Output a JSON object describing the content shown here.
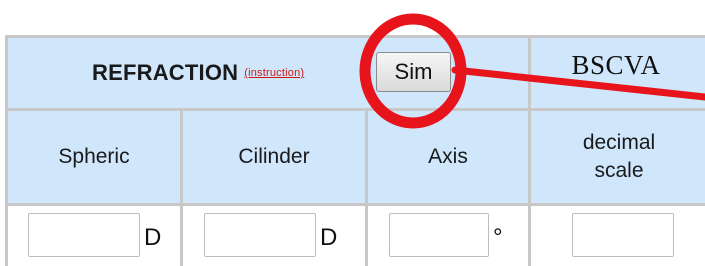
{
  "refraction": {
    "title": "REFRACTION",
    "instructions_link": "(instruction)",
    "sim_button": "Sim",
    "columns": [
      "Spheric",
      "Cilinder",
      "Axis"
    ],
    "units": [
      "D",
      "D",
      "°"
    ]
  },
  "bscva": {
    "title": "BSCVA",
    "column_line1": "decimal",
    "column_line2": "scale"
  },
  "colors": {
    "header_bg": "#cfe6fb",
    "border": "#c8c8c8",
    "annotation": "#e8141c",
    "link": "#d01818"
  },
  "icons": [
    "circle-annotation-icon",
    "arrow-annotation-icon"
  ]
}
